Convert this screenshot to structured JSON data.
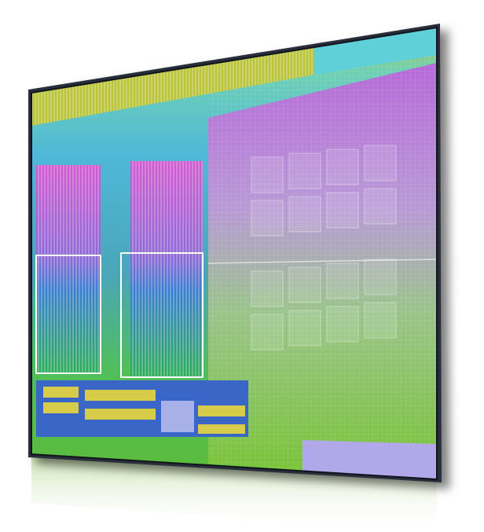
{
  "image": {
    "subject": "processor-die-photo",
    "background_color": "#ffffff",
    "has_reflection": true,
    "palette": {
      "frame": "#2a2f3a",
      "top_band": "#b9c43a",
      "top_right_cyan": "#5fd0d8",
      "upper_left_cyan": "#3fc0c8",
      "upper_right_purple": "#b66ad8",
      "lower_right_green": "#78c436",
      "core_magenta": "#c25ac8",
      "cache_blue": "#3b7fd0",
      "cache_green": "#2fae5a",
      "io_blue": "#3a66c8",
      "io_yellow": "#d6cc4a"
    }
  }
}
